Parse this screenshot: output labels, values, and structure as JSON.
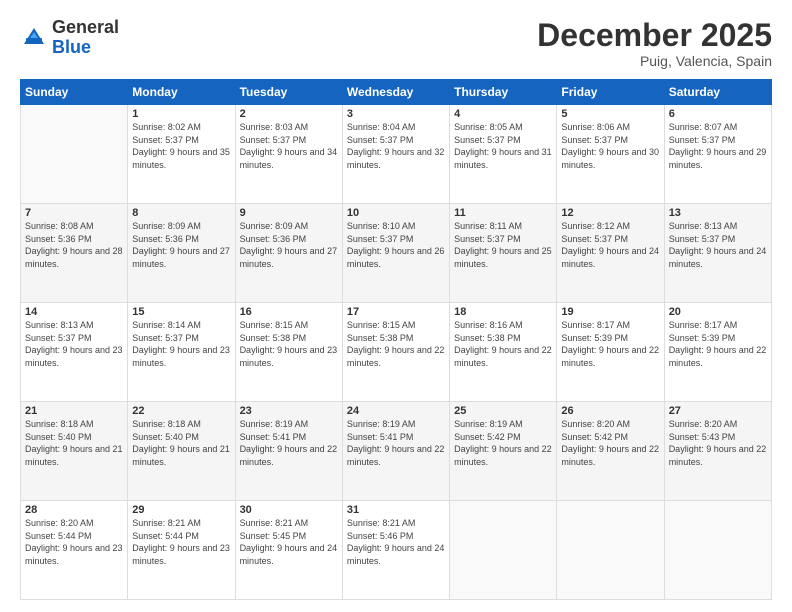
{
  "logo": {
    "general": "General",
    "blue": "Blue"
  },
  "header": {
    "month": "December 2025",
    "location": "Puig, Valencia, Spain"
  },
  "weekdays": [
    "Sunday",
    "Monday",
    "Tuesday",
    "Wednesday",
    "Thursday",
    "Friday",
    "Saturday"
  ],
  "weeks": [
    [
      {
        "day": "",
        "sunrise": "",
        "sunset": "",
        "daylight": ""
      },
      {
        "day": "1",
        "sunrise": "Sunrise: 8:02 AM",
        "sunset": "Sunset: 5:37 PM",
        "daylight": "Daylight: 9 hours and 35 minutes."
      },
      {
        "day": "2",
        "sunrise": "Sunrise: 8:03 AM",
        "sunset": "Sunset: 5:37 PM",
        "daylight": "Daylight: 9 hours and 34 minutes."
      },
      {
        "day": "3",
        "sunrise": "Sunrise: 8:04 AM",
        "sunset": "Sunset: 5:37 PM",
        "daylight": "Daylight: 9 hours and 32 minutes."
      },
      {
        "day": "4",
        "sunrise": "Sunrise: 8:05 AM",
        "sunset": "Sunset: 5:37 PM",
        "daylight": "Daylight: 9 hours and 31 minutes."
      },
      {
        "day": "5",
        "sunrise": "Sunrise: 8:06 AM",
        "sunset": "Sunset: 5:37 PM",
        "daylight": "Daylight: 9 hours and 30 minutes."
      },
      {
        "day": "6",
        "sunrise": "Sunrise: 8:07 AM",
        "sunset": "Sunset: 5:37 PM",
        "daylight": "Daylight: 9 hours and 29 minutes."
      }
    ],
    [
      {
        "day": "7",
        "sunrise": "Sunrise: 8:08 AM",
        "sunset": "Sunset: 5:36 PM",
        "daylight": "Daylight: 9 hours and 28 minutes."
      },
      {
        "day": "8",
        "sunrise": "Sunrise: 8:09 AM",
        "sunset": "Sunset: 5:36 PM",
        "daylight": "Daylight: 9 hours and 27 minutes."
      },
      {
        "day": "9",
        "sunrise": "Sunrise: 8:09 AM",
        "sunset": "Sunset: 5:36 PM",
        "daylight": "Daylight: 9 hours and 27 minutes."
      },
      {
        "day": "10",
        "sunrise": "Sunrise: 8:10 AM",
        "sunset": "Sunset: 5:37 PM",
        "daylight": "Daylight: 9 hours and 26 minutes."
      },
      {
        "day": "11",
        "sunrise": "Sunrise: 8:11 AM",
        "sunset": "Sunset: 5:37 PM",
        "daylight": "Daylight: 9 hours and 25 minutes."
      },
      {
        "day": "12",
        "sunrise": "Sunrise: 8:12 AM",
        "sunset": "Sunset: 5:37 PM",
        "daylight": "Daylight: 9 hours and 24 minutes."
      },
      {
        "day": "13",
        "sunrise": "Sunrise: 8:13 AM",
        "sunset": "Sunset: 5:37 PM",
        "daylight": "Daylight: 9 hours and 24 minutes."
      }
    ],
    [
      {
        "day": "14",
        "sunrise": "Sunrise: 8:13 AM",
        "sunset": "Sunset: 5:37 PM",
        "daylight": "Daylight: 9 hours and 23 minutes."
      },
      {
        "day": "15",
        "sunrise": "Sunrise: 8:14 AM",
        "sunset": "Sunset: 5:37 PM",
        "daylight": "Daylight: 9 hours and 23 minutes."
      },
      {
        "day": "16",
        "sunrise": "Sunrise: 8:15 AM",
        "sunset": "Sunset: 5:38 PM",
        "daylight": "Daylight: 9 hours and 23 minutes."
      },
      {
        "day": "17",
        "sunrise": "Sunrise: 8:15 AM",
        "sunset": "Sunset: 5:38 PM",
        "daylight": "Daylight: 9 hours and 22 minutes."
      },
      {
        "day": "18",
        "sunrise": "Sunrise: 8:16 AM",
        "sunset": "Sunset: 5:38 PM",
        "daylight": "Daylight: 9 hours and 22 minutes."
      },
      {
        "day": "19",
        "sunrise": "Sunrise: 8:17 AM",
        "sunset": "Sunset: 5:39 PM",
        "daylight": "Daylight: 9 hours and 22 minutes."
      },
      {
        "day": "20",
        "sunrise": "Sunrise: 8:17 AM",
        "sunset": "Sunset: 5:39 PM",
        "daylight": "Daylight: 9 hours and 22 minutes."
      }
    ],
    [
      {
        "day": "21",
        "sunrise": "Sunrise: 8:18 AM",
        "sunset": "Sunset: 5:40 PM",
        "daylight": "Daylight: 9 hours and 21 minutes."
      },
      {
        "day": "22",
        "sunrise": "Sunrise: 8:18 AM",
        "sunset": "Sunset: 5:40 PM",
        "daylight": "Daylight: 9 hours and 21 minutes."
      },
      {
        "day": "23",
        "sunrise": "Sunrise: 8:19 AM",
        "sunset": "Sunset: 5:41 PM",
        "daylight": "Daylight: 9 hours and 22 minutes."
      },
      {
        "day": "24",
        "sunrise": "Sunrise: 8:19 AM",
        "sunset": "Sunset: 5:41 PM",
        "daylight": "Daylight: 9 hours and 22 minutes."
      },
      {
        "day": "25",
        "sunrise": "Sunrise: 8:19 AM",
        "sunset": "Sunset: 5:42 PM",
        "daylight": "Daylight: 9 hours and 22 minutes."
      },
      {
        "day": "26",
        "sunrise": "Sunrise: 8:20 AM",
        "sunset": "Sunset: 5:42 PM",
        "daylight": "Daylight: 9 hours and 22 minutes."
      },
      {
        "day": "27",
        "sunrise": "Sunrise: 8:20 AM",
        "sunset": "Sunset: 5:43 PM",
        "daylight": "Daylight: 9 hours and 22 minutes."
      }
    ],
    [
      {
        "day": "28",
        "sunrise": "Sunrise: 8:20 AM",
        "sunset": "Sunset: 5:44 PM",
        "daylight": "Daylight: 9 hours and 23 minutes."
      },
      {
        "day": "29",
        "sunrise": "Sunrise: 8:21 AM",
        "sunset": "Sunset: 5:44 PM",
        "daylight": "Daylight: 9 hours and 23 minutes."
      },
      {
        "day": "30",
        "sunrise": "Sunrise: 8:21 AM",
        "sunset": "Sunset: 5:45 PM",
        "daylight": "Daylight: 9 hours and 24 minutes."
      },
      {
        "day": "31",
        "sunrise": "Sunrise: 8:21 AM",
        "sunset": "Sunset: 5:46 PM",
        "daylight": "Daylight: 9 hours and 24 minutes."
      },
      {
        "day": "",
        "sunrise": "",
        "sunset": "",
        "daylight": ""
      },
      {
        "day": "",
        "sunrise": "",
        "sunset": "",
        "daylight": ""
      },
      {
        "day": "",
        "sunrise": "",
        "sunset": "",
        "daylight": ""
      }
    ]
  ]
}
